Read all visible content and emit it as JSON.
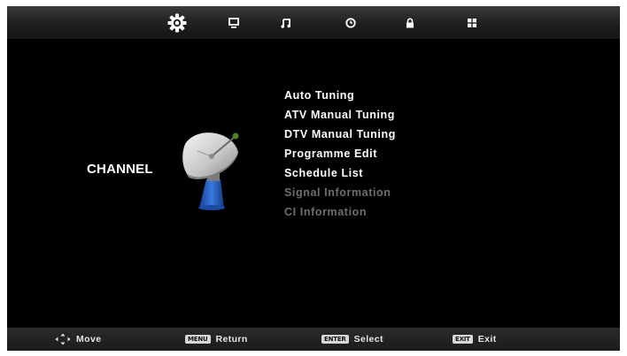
{
  "top_tabs": [
    {
      "icon": "gear-icon",
      "active": true
    },
    {
      "icon": "monitor-icon",
      "active": false
    },
    {
      "icon": "music-note-icon",
      "active": false
    },
    {
      "icon": "clock-icon",
      "active": false
    },
    {
      "icon": "lock-icon",
      "active": false
    },
    {
      "icon": "grid-icon",
      "active": false
    }
  ],
  "section": {
    "title": "CHANNEL",
    "icon": "satellite-dish-icon"
  },
  "menu": {
    "items": [
      {
        "label": "Auto Tuning",
        "enabled": true
      },
      {
        "label": "ATV Manual Tuning",
        "enabled": true
      },
      {
        "label": "DTV Manual Tuning",
        "enabled": true
      },
      {
        "label": "Programme Edit",
        "enabled": true
      },
      {
        "label": "Schedule List",
        "enabled": true
      },
      {
        "label": "Signal Information",
        "enabled": false
      },
      {
        "label": "CI Information",
        "enabled": false
      }
    ]
  },
  "bottom_hints": {
    "move": {
      "label": "Move",
      "icon": "arrows-icon"
    },
    "return": {
      "key": "MENU",
      "label": "Return"
    },
    "select": {
      "key": "ENTER",
      "label": "Select"
    },
    "exit": {
      "key": "EXIT",
      "label": "Exit"
    }
  },
  "colors": {
    "background": "#000000",
    "text_enabled": "#ffffff",
    "text_disabled": "#6e6e6e",
    "dish_blue": "#2a5fc4"
  }
}
